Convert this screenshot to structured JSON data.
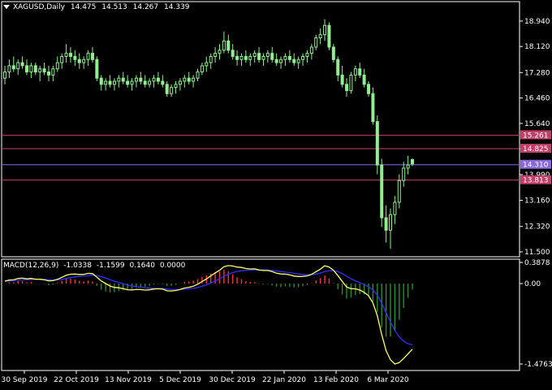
{
  "symbol": "XAGUSD,Daily",
  "ohlc": {
    "open": "14.475",
    "high": "14.513",
    "low": "14.267",
    "close": "14.339"
  },
  "colors": {
    "background": "#000000",
    "bull_candle": "#90ee90",
    "bear_candle": "#90ee90",
    "hline": "#c0406a",
    "current_price_line": "#8a6ad8",
    "macd_pos_hist": "#ff3030",
    "macd_neg_hist": "#2e8b2e",
    "macd_line": "#ffff66",
    "signal_line": "#3030ff",
    "axis_text": "#ffffff",
    "frame": "#ffffff"
  },
  "price_axis": {
    "labels": [
      "18.940",
      "18.120",
      "17.280",
      "16.460",
      "15.640",
      "14.825",
      "13.990",
      "13.160",
      "12.320",
      "11.500"
    ],
    "level_tags": [
      {
        "text": "15.261",
        "color": "#c0406a"
      },
      {
        "text": "14.825",
        "color": "#c0406a"
      },
      {
        "text": "14.310",
        "color": "#8a6ad8"
      },
      {
        "text": "13.813",
        "color": "#c0406a"
      }
    ]
  },
  "macd": {
    "title": "MACD(12,26,9)",
    "values": [
      "-1.0338",
      "-1.1599",
      "0.1640",
      "0.0000"
    ],
    "axis_labels": [
      "0.3878",
      "0.00",
      "-1.4763"
    ]
  },
  "time_axis": [
    "30 Sep 2019",
    "22 Oct 2019",
    "13 Nov 2019",
    "5 Dec 2019",
    "30 Dec 2019",
    "22 Jan 2020",
    "13 Feb 2020",
    "6 Mar 2020"
  ],
  "chart_data": {
    "type": "candlestick",
    "series": [
      {
        "name": "XAGUSD,Daily",
        "ohlc_approx": [
          [
            17.1,
            17.5,
            16.9,
            17.3
          ],
          [
            17.3,
            17.7,
            17.1,
            17.5
          ],
          [
            17.5,
            17.8,
            17.3,
            17.4
          ],
          [
            17.4,
            17.7,
            17.2,
            17.6
          ],
          [
            17.6,
            17.8,
            17.4,
            17.5
          ],
          [
            17.5,
            17.7,
            17.2,
            17.3
          ],
          [
            17.3,
            17.6,
            17.1,
            17.5
          ],
          [
            17.5,
            17.6,
            17.2,
            17.3
          ],
          [
            17.3,
            17.5,
            17.0,
            17.4
          ],
          [
            17.4,
            17.6,
            17.2,
            17.3
          ],
          [
            17.3,
            17.5,
            17.0,
            17.2
          ],
          [
            17.2,
            17.5,
            17.0,
            17.4
          ],
          [
            17.4,
            17.8,
            17.3,
            17.6
          ],
          [
            17.6,
            17.9,
            17.4,
            17.8
          ],
          [
            17.8,
            18.2,
            17.6,
            17.9
          ],
          [
            17.9,
            18.1,
            17.6,
            17.8
          ],
          [
            17.8,
            18.0,
            17.5,
            17.7
          ],
          [
            17.7,
            17.9,
            17.4,
            17.6
          ],
          [
            17.6,
            17.8,
            17.4,
            17.7
          ],
          [
            17.7,
            18.0,
            17.5,
            17.9
          ],
          [
            17.9,
            18.1,
            17.6,
            17.7
          ],
          [
            17.7,
            17.8,
            17.0,
            17.1
          ],
          [
            17.1,
            17.2,
            16.7,
            16.9
          ],
          [
            16.9,
            17.1,
            16.7,
            17.0
          ],
          [
            17.0,
            17.2,
            16.8,
            16.9
          ],
          [
            16.9,
            17.1,
            16.7,
            17.0
          ],
          [
            17.0,
            17.2,
            16.8,
            17.1
          ],
          [
            17.1,
            17.3,
            16.9,
            17.0
          ],
          [
            17.0,
            17.2,
            16.8,
            16.9
          ],
          [
            16.9,
            17.1,
            16.7,
            17.0
          ],
          [
            17.0,
            17.2,
            16.8,
            17.1
          ],
          [
            17.1,
            17.3,
            16.9,
            17.0
          ],
          [
            17.0,
            17.2,
            16.8,
            16.9
          ],
          [
            16.9,
            17.1,
            16.8,
            17.0
          ],
          [
            17.0,
            17.2,
            16.8,
            17.1
          ],
          [
            17.1,
            17.3,
            16.9,
            17.0
          ],
          [
            17.0,
            17.2,
            16.8,
            16.9
          ],
          [
            16.9,
            17.0,
            16.5,
            16.6
          ],
          [
            16.6,
            16.9,
            16.5,
            16.8
          ],
          [
            16.8,
            17.0,
            16.6,
            16.9
          ],
          [
            16.9,
            17.1,
            16.7,
            17.0
          ],
          [
            17.0,
            17.2,
            16.8,
            17.1
          ],
          [
            17.1,
            17.3,
            16.9,
            17.0
          ],
          [
            17.0,
            17.2,
            16.8,
            17.1
          ],
          [
            17.1,
            17.4,
            17.0,
            17.3
          ],
          [
            17.3,
            17.6,
            17.2,
            17.5
          ],
          [
            17.5,
            17.8,
            17.3,
            17.6
          ],
          [
            17.6,
            17.9,
            17.4,
            17.8
          ],
          [
            17.8,
            18.1,
            17.6,
            17.9
          ],
          [
            17.9,
            18.2,
            17.7,
            18.0
          ],
          [
            18.0,
            18.6,
            17.9,
            18.3
          ],
          [
            18.3,
            18.5,
            17.9,
            18.0
          ],
          [
            18.0,
            18.2,
            17.7,
            17.8
          ],
          [
            17.8,
            18.0,
            17.5,
            17.7
          ],
          [
            17.7,
            17.9,
            17.5,
            17.8
          ],
          [
            17.8,
            18.0,
            17.6,
            17.7
          ],
          [
            17.7,
            17.9,
            17.5,
            17.8
          ],
          [
            17.8,
            18.0,
            17.6,
            17.9
          ],
          [
            17.9,
            18.1,
            17.6,
            17.7
          ],
          [
            17.7,
            17.9,
            17.5,
            17.8
          ],
          [
            17.8,
            18.0,
            17.6,
            17.9
          ],
          [
            17.9,
            18.1,
            17.6,
            17.7
          ],
          [
            17.7,
            17.9,
            17.5,
            17.6
          ],
          [
            17.6,
            17.8,
            17.4,
            17.7
          ],
          [
            17.7,
            17.9,
            17.5,
            17.8
          ],
          [
            17.8,
            18.0,
            17.6,
            17.7
          ],
          [
            17.7,
            17.9,
            17.5,
            17.6
          ],
          [
            17.6,
            17.8,
            17.4,
            17.7
          ],
          [
            17.7,
            17.9,
            17.5,
            17.8
          ],
          [
            17.8,
            18.0,
            17.6,
            17.9
          ],
          [
            17.9,
            18.2,
            17.7,
            18.1
          ],
          [
            18.1,
            18.5,
            18.0,
            18.4
          ],
          [
            18.4,
            18.7,
            18.2,
            18.5
          ],
          [
            18.5,
            19.0,
            18.3,
            18.8
          ],
          [
            18.8,
            18.9,
            18.0,
            18.1
          ],
          [
            18.1,
            18.2,
            17.6,
            17.7
          ],
          [
            17.7,
            17.8,
            17.0,
            17.2
          ],
          [
            17.2,
            17.5,
            16.8,
            16.9
          ],
          [
            16.9,
            17.1,
            16.5,
            16.7
          ],
          [
            16.7,
            17.3,
            16.6,
            17.2
          ],
          [
            17.2,
            17.5,
            17.0,
            17.4
          ],
          [
            17.4,
            17.6,
            17.1,
            17.2
          ],
          [
            17.2,
            17.4,
            16.8,
            16.9
          ],
          [
            16.9,
            17.0,
            16.5,
            16.6
          ],
          [
            16.6,
            16.8,
            15.6,
            15.7
          ],
          [
            15.7,
            15.9,
            14.0,
            14.3
          ],
          [
            14.3,
            14.5,
            12.3,
            12.6
          ],
          [
            12.6,
            13.0,
            11.8,
            12.2
          ],
          [
            12.2,
            12.9,
            11.6,
            12.7
          ],
          [
            12.7,
            13.3,
            12.4,
            13.1
          ],
          [
            13.1,
            14.0,
            12.9,
            13.8
          ],
          [
            13.8,
            14.4,
            13.6,
            14.2
          ],
          [
            14.2,
            14.6,
            14.0,
            14.3
          ],
          [
            14.475,
            14.513,
            14.267,
            14.339
          ]
        ]
      }
    ],
    "price_range": [
      11.5,
      19.2
    ],
    "macd": {
      "macd": -1.0338,
      "signal": -1.1599,
      "histogram": 0.164,
      "range": [
        -1.4763,
        0.3878
      ]
    },
    "grid": false
  }
}
